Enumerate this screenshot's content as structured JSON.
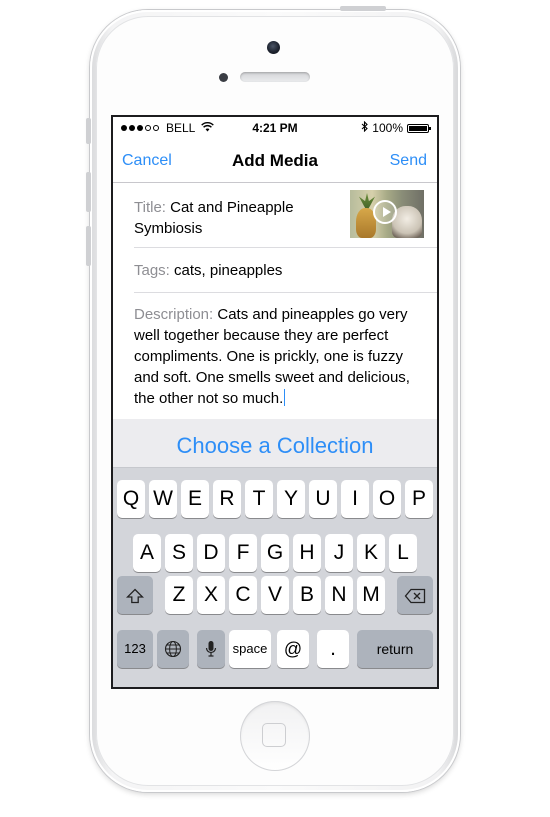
{
  "status_bar": {
    "carrier": "BELL",
    "time": "4:21 PM",
    "battery": "100%",
    "signal_bars_filled": 3,
    "signal_bars_total": 5,
    "battery_level": 1.0
  },
  "nav": {
    "cancel_label": "Cancel",
    "title": "Add Media",
    "send_label": "Send"
  },
  "form": {
    "title_label": "Title:",
    "title_value": "Cat and Pineapple Symbiosis",
    "tags_label": "Tags:",
    "tags_value": "cats, pineapples",
    "description_label": "Description:",
    "description_value": "Cats and pineapples go very well together because they are perfect compliments. One is prickly, one is fuzzy and soft. One smells sweet and delicious, the other not so much."
  },
  "choose_collection_label": "Choose a Collection",
  "keyboard": {
    "row1": [
      "Q",
      "W",
      "E",
      "R",
      "T",
      "Y",
      "U",
      "I",
      "O",
      "P"
    ],
    "row2": [
      "A",
      "S",
      "D",
      "F",
      "G",
      "H",
      "J",
      "K",
      "L"
    ],
    "row3": [
      "Z",
      "X",
      "C",
      "V",
      "B",
      "N",
      "M"
    ],
    "numbers_label": "123",
    "space_label": "space",
    "at_label": "@",
    "period_label": ".",
    "return_label": "return",
    "shift_icon": "shift-icon",
    "delete_icon": "backspace-icon",
    "globe_icon": "globe-icon",
    "mic_icon": "microphone-icon"
  },
  "colors": {
    "accent": "#2d8ef7",
    "label_gray": "#8e8e93",
    "keyboard_bg": "#d3d5da"
  }
}
